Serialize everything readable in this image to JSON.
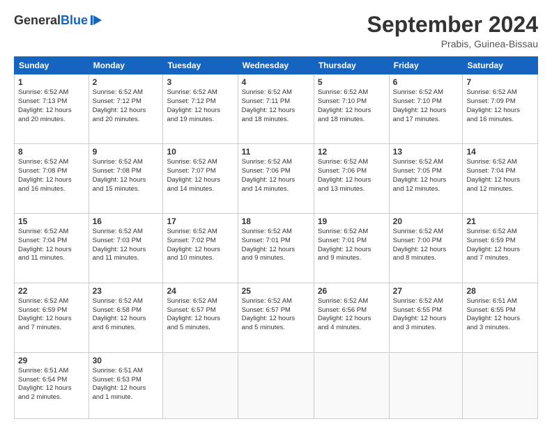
{
  "logo": {
    "general": "General",
    "blue": "Blue"
  },
  "header": {
    "month": "September 2024",
    "location": "Prabis, Guinea-Bissau"
  },
  "weekdays": [
    "Sunday",
    "Monday",
    "Tuesday",
    "Wednesday",
    "Thursday",
    "Friday",
    "Saturday"
  ],
  "weeks": [
    [
      {
        "day": "1",
        "info": "Sunrise: 6:52 AM\nSunset: 7:13 PM\nDaylight: 12 hours\nand 20 minutes."
      },
      {
        "day": "2",
        "info": "Sunrise: 6:52 AM\nSunset: 7:12 PM\nDaylight: 12 hours\nand 20 minutes."
      },
      {
        "day": "3",
        "info": "Sunrise: 6:52 AM\nSunset: 7:12 PM\nDaylight: 12 hours\nand 19 minutes."
      },
      {
        "day": "4",
        "info": "Sunrise: 6:52 AM\nSunset: 7:11 PM\nDaylight: 12 hours\nand 18 minutes."
      },
      {
        "day": "5",
        "info": "Sunrise: 6:52 AM\nSunset: 7:10 PM\nDaylight: 12 hours\nand 18 minutes."
      },
      {
        "day": "6",
        "info": "Sunrise: 6:52 AM\nSunset: 7:10 PM\nDaylight: 12 hours\nand 17 minutes."
      },
      {
        "day": "7",
        "info": "Sunrise: 6:52 AM\nSunset: 7:09 PM\nDaylight: 12 hours\nand 16 minutes."
      }
    ],
    [
      {
        "day": "8",
        "info": "Sunrise: 6:52 AM\nSunset: 7:08 PM\nDaylight: 12 hours\nand 16 minutes."
      },
      {
        "day": "9",
        "info": "Sunrise: 6:52 AM\nSunset: 7:08 PM\nDaylight: 12 hours\nand 15 minutes."
      },
      {
        "day": "10",
        "info": "Sunrise: 6:52 AM\nSunset: 7:07 PM\nDaylight: 12 hours\nand 14 minutes."
      },
      {
        "day": "11",
        "info": "Sunrise: 6:52 AM\nSunset: 7:06 PM\nDaylight: 12 hours\nand 14 minutes."
      },
      {
        "day": "12",
        "info": "Sunrise: 6:52 AM\nSunset: 7:06 PM\nDaylight: 12 hours\nand 13 minutes."
      },
      {
        "day": "13",
        "info": "Sunrise: 6:52 AM\nSunset: 7:05 PM\nDaylight: 12 hours\nand 12 minutes."
      },
      {
        "day": "14",
        "info": "Sunrise: 6:52 AM\nSunset: 7:04 PM\nDaylight: 12 hours\nand 12 minutes."
      }
    ],
    [
      {
        "day": "15",
        "info": "Sunrise: 6:52 AM\nSunset: 7:04 PM\nDaylight: 12 hours\nand 11 minutes."
      },
      {
        "day": "16",
        "info": "Sunrise: 6:52 AM\nSunset: 7:03 PM\nDaylight: 12 hours\nand 11 minutes."
      },
      {
        "day": "17",
        "info": "Sunrise: 6:52 AM\nSunset: 7:02 PM\nDaylight: 12 hours\nand 10 minutes."
      },
      {
        "day": "18",
        "info": "Sunrise: 6:52 AM\nSunset: 7:01 PM\nDaylight: 12 hours\nand 9 minutes."
      },
      {
        "day": "19",
        "info": "Sunrise: 6:52 AM\nSunset: 7:01 PM\nDaylight: 12 hours\nand 9 minutes."
      },
      {
        "day": "20",
        "info": "Sunrise: 6:52 AM\nSunset: 7:00 PM\nDaylight: 12 hours\nand 8 minutes."
      },
      {
        "day": "21",
        "info": "Sunrise: 6:52 AM\nSunset: 6:59 PM\nDaylight: 12 hours\nand 7 minutes."
      }
    ],
    [
      {
        "day": "22",
        "info": "Sunrise: 6:52 AM\nSunset: 6:59 PM\nDaylight: 12 hours\nand 7 minutes."
      },
      {
        "day": "23",
        "info": "Sunrise: 6:52 AM\nSunset: 6:58 PM\nDaylight: 12 hours\nand 6 minutes."
      },
      {
        "day": "24",
        "info": "Sunrise: 6:52 AM\nSunset: 6:57 PM\nDaylight: 12 hours\nand 5 minutes."
      },
      {
        "day": "25",
        "info": "Sunrise: 6:52 AM\nSunset: 6:57 PM\nDaylight: 12 hours\nand 5 minutes."
      },
      {
        "day": "26",
        "info": "Sunrise: 6:52 AM\nSunset: 6:56 PM\nDaylight: 12 hours\nand 4 minutes."
      },
      {
        "day": "27",
        "info": "Sunrise: 6:52 AM\nSunset: 6:55 PM\nDaylight: 12 hours\nand 3 minutes."
      },
      {
        "day": "28",
        "info": "Sunrise: 6:51 AM\nSunset: 6:55 PM\nDaylight: 12 hours\nand 3 minutes."
      }
    ],
    [
      {
        "day": "29",
        "info": "Sunrise: 6:51 AM\nSunset: 6:54 PM\nDaylight: 12 hours\nand 2 minutes."
      },
      {
        "day": "30",
        "info": "Sunrise: 6:51 AM\nSunset: 6:53 PM\nDaylight: 12 hours\nand 1 minute."
      },
      null,
      null,
      null,
      null,
      null
    ]
  ]
}
